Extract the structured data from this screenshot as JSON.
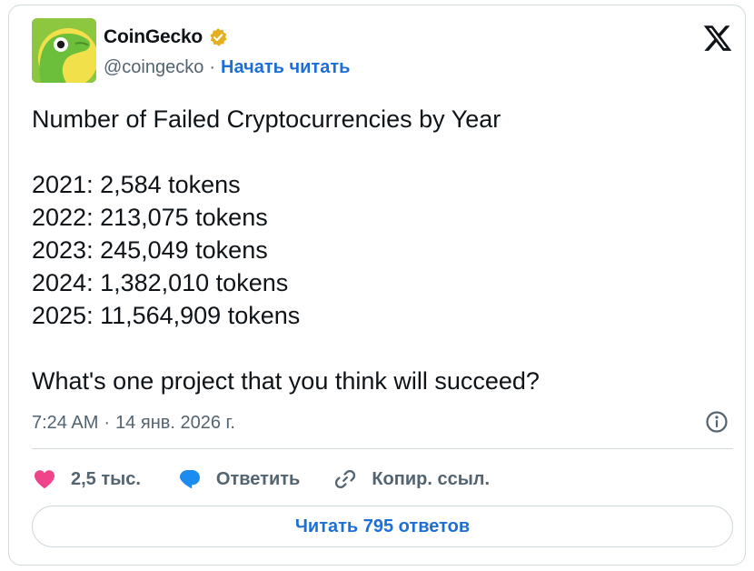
{
  "author": {
    "display_name": "CoinGecko",
    "handle": "@coingecko",
    "separator": "·",
    "follow_label": "Начать читать",
    "verified_badge": "gold-verified-badge-icon",
    "avatar_icon": "coingecko-gecko-logo"
  },
  "platform_logo": "x-logo-icon",
  "tweet": {
    "lines": [
      "Number of Failed Cryptocurrencies by Year",
      "",
      "2021: 2,584 tokens",
      "2022: 213,075 tokens",
      "2023: 245,049 tokens",
      "2024: 1,382,010 tokens",
      "2025: 11,564,909 tokens",
      "",
      "What's one project that you think will succeed?"
    ]
  },
  "meta": {
    "time": "7:24 AM",
    "separator": "·",
    "date": "14 янв. 2026 г."
  },
  "actions": {
    "like_count": "2,5 тыс.",
    "reply_label": "Ответить",
    "copy_link_label": "Копир. ссыл."
  },
  "read_replies_label": "Читать 795 ответов",
  "colors": {
    "link_blue": "#1d6fd6",
    "like_pink": "#f0438a",
    "reply_blue": "#1d8cf0",
    "secondary_text": "#536471",
    "border": "#cfd9de",
    "badge_gold": "#e3b11f",
    "avatar_green": "#8dc63f"
  }
}
